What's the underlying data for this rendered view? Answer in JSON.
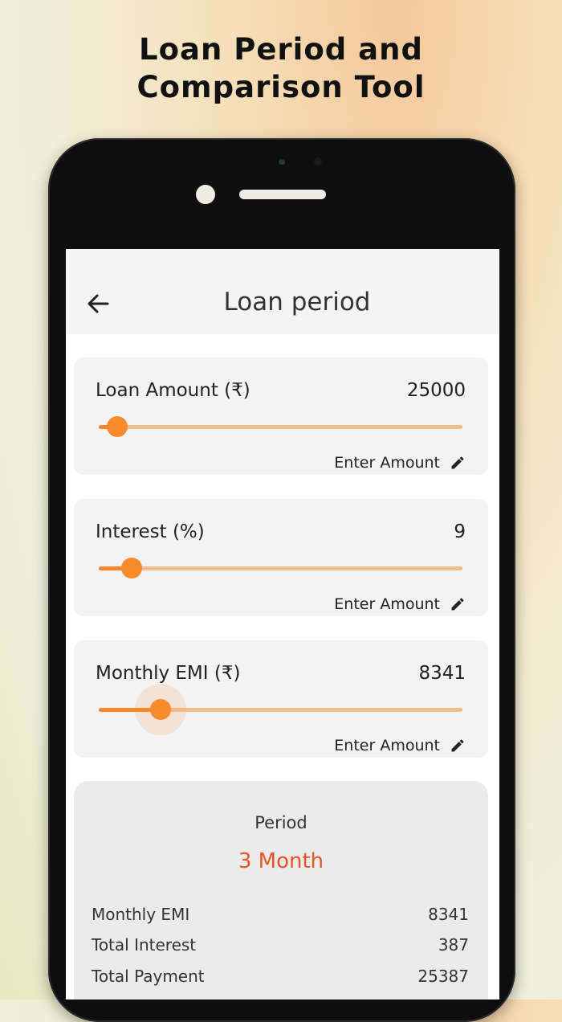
{
  "headline": {
    "line1": "Loan Period and",
    "line2": "Comparison Tool"
  },
  "appbar": {
    "title": "Loan period",
    "back_icon": "arrow-left-icon"
  },
  "cards": [
    {
      "label": "Loan Amount (₹)",
      "value": "25000",
      "slider_fraction": 0.05,
      "action": "Enter Amount",
      "action_icon": "pencil-icon"
    },
    {
      "label": "Interest (%)",
      "value": "9",
      "slider_fraction": 0.09,
      "action": "Enter Amount",
      "action_icon": "pencil-icon"
    },
    {
      "label": "Monthly EMI (₹)",
      "value": "8341",
      "slider_fraction": 0.17,
      "action": "Enter Amount",
      "action_icon": "pencil-icon"
    }
  ],
  "result": {
    "period_label": "Period",
    "period_value": "3 Month",
    "rows": [
      {
        "label": "Monthly EMI",
        "value": "8341"
      },
      {
        "label": "Total Interest",
        "value": "387"
      },
      {
        "label": "Total Payment",
        "value": "25387"
      }
    ]
  },
  "colors": {
    "accent": "#f78a2a",
    "track": "#f2be8e",
    "period": "#ec5428"
  }
}
